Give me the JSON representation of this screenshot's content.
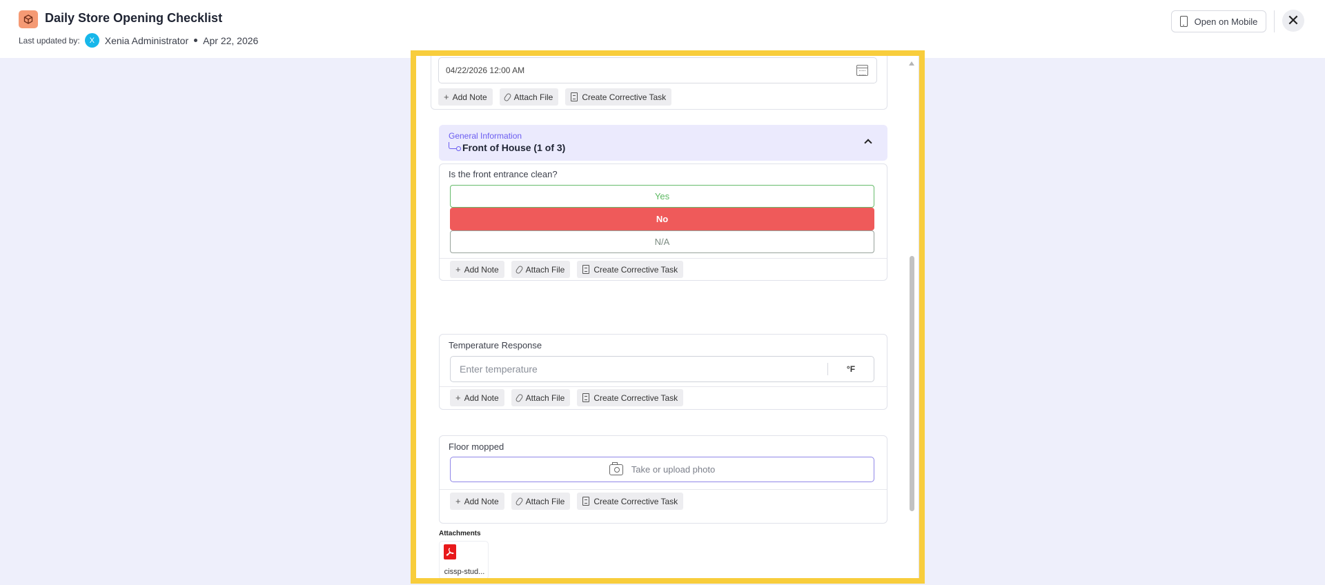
{
  "header": {
    "title": "Daily Store Opening Checklist",
    "last_updated_label": "Last updated by:",
    "avatar_initial": "X",
    "user_name": "Xenia Administrator",
    "date": "Apr 22, 2026",
    "open_mobile_label": "Open on Mobile",
    "close_symbol": "✕"
  },
  "colors": {
    "accent": "#6a5cf0",
    "frame_highlight": "#f8cd3c",
    "no_selected": "#ef5a5a",
    "yes": "#66bb6a",
    "avatar": "#17b7ea"
  },
  "actions": {
    "add_note": "Add Note",
    "attach_file": "Attach File",
    "create_task": "Create Corrective Task"
  },
  "date_field": {
    "value": "04/22/2026 12:00 AM"
  },
  "section": {
    "subtitle": "General Information",
    "title": "Front of House (1 of 3)"
  },
  "questions": [
    {
      "label": "Is the front entrance clean?",
      "options": [
        "Yes",
        "No",
        "N/A"
      ],
      "selected": "No"
    },
    {
      "label": "Temperature Response",
      "placeholder": "Enter temperature",
      "unit": "°F"
    },
    {
      "label": "Floor mopped",
      "photo_label": "Take or upload photo"
    }
  ],
  "attachments": {
    "title": "Attachments",
    "files": [
      {
        "name": "cissp-stud...",
        "icon": "pdf-icon"
      }
    ]
  }
}
